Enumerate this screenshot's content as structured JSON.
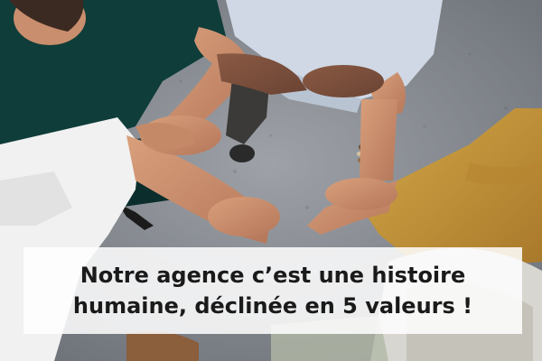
{
  "banner": {
    "caption_line_1": "Notre agence c’est une histoire",
    "caption_line_2": "humaine, déclinée en 5 valeurs !"
  },
  "colors": {
    "caption_background": "#ffffff",
    "caption_text": "#1a1a1a",
    "floor": "#8a8f96",
    "dark_green_top": "#0f3d3a",
    "mustard_sweater": "#c99a3a",
    "light_blue_shirt": "#cfd8e4",
    "skin": "#c98e6d"
  }
}
